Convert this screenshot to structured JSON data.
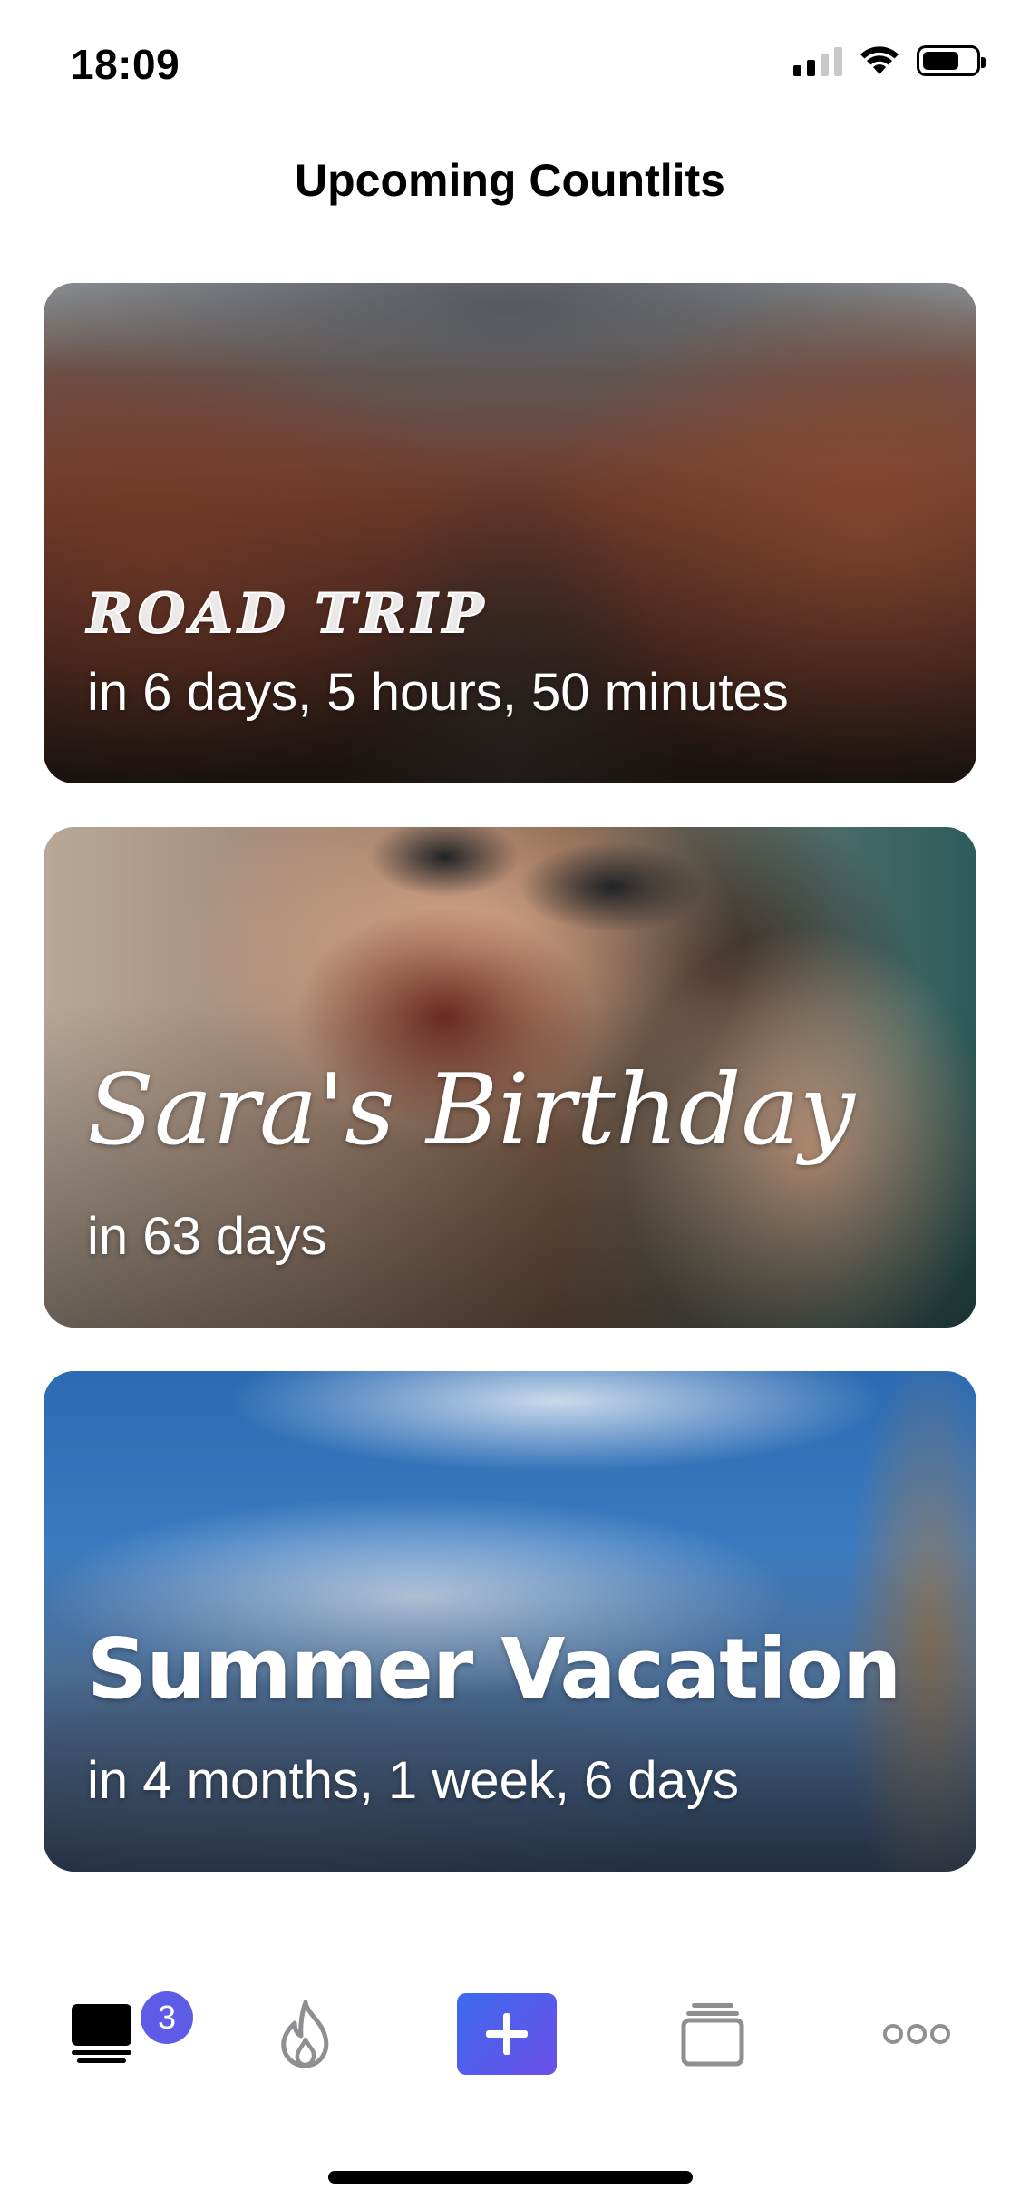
{
  "status_bar": {
    "time": "18:09",
    "signal_icon": "cellular-signal-icon",
    "wifi_icon": "wifi-icon",
    "battery_icon": "battery-icon",
    "battery_level": 0.7
  },
  "header": {
    "title": "Upcoming Countlits"
  },
  "countdowns": [
    {
      "title": "Road Trip",
      "subtitle": "in 6 days, 5 hours, 50 minutes"
    },
    {
      "title": "Sara's Birthday",
      "subtitle": "in 63 days"
    },
    {
      "title": "Summer Vacation",
      "subtitle": "in 4 months, 1 week, 6 days"
    }
  ],
  "tab_bar": {
    "home_icon": "home-list-icon",
    "badge_count": "3",
    "flame_icon": "flame-icon",
    "add_icon": "plus-icon",
    "cards_icon": "stacked-cards-icon",
    "more_icon": "more-dots-icon",
    "add_color_start": "#3d6af0",
    "add_color_end": "#6b4fe6",
    "badge_color": "#5e5ce6"
  }
}
